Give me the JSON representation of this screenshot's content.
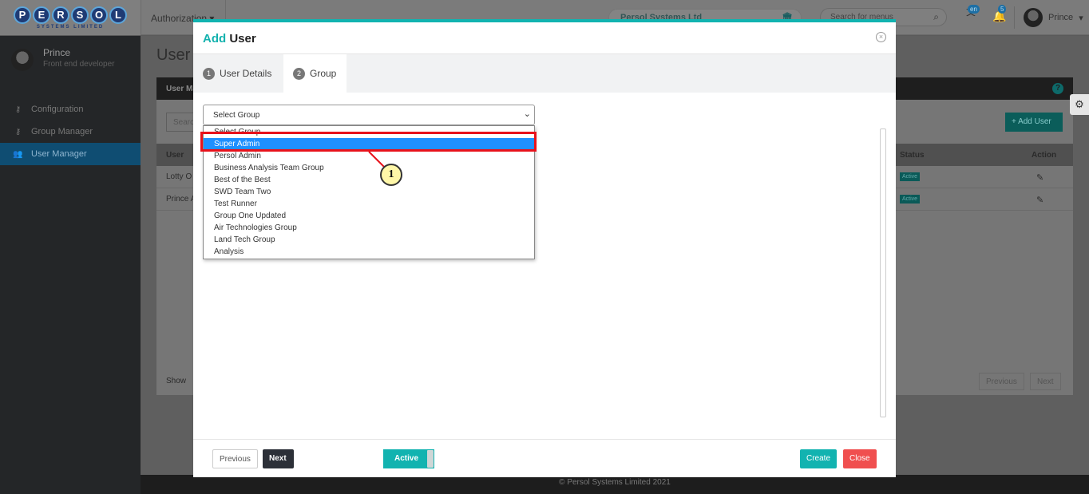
{
  "app": {
    "logo_letters": [
      "P",
      "E",
      "R",
      "S",
      "O",
      "L"
    ],
    "logo_sub": "SYSTEMS LIMITED",
    "menu": "Authorization",
    "company": "Persol Systems Ltd",
    "search_placeholder": "Search for menus",
    "lang_badge": "en",
    "notif_badge": "5",
    "user": "Prince"
  },
  "sidebar": {
    "name": "Prince",
    "role": "Front end developer",
    "items": [
      {
        "label": "Configuration",
        "icon": "key-icon"
      },
      {
        "label": "Group Manager",
        "icon": "key-icon"
      },
      {
        "label": "User Manager",
        "icon": "users-icon",
        "active": true
      }
    ]
  },
  "background": {
    "title": "User",
    "card_head": "User Ma",
    "search": "Searc",
    "add_user": "Add User",
    "columns": {
      "user": "User",
      "status": "Status",
      "action": "Action"
    },
    "rows": [
      {
        "user": "Lotty O",
        "status": "Active"
      },
      {
        "user": "Prince A",
        "status": "Active"
      }
    ],
    "show_label": "Show",
    "previous": "Previous",
    "next": "Next"
  },
  "modal": {
    "title_prefix": "Add",
    "title_suffix": "User",
    "tabs": [
      {
        "num": "1",
        "label": "User Details"
      },
      {
        "num": "2",
        "label": "Group",
        "active": true
      }
    ],
    "select_value": "Select Group",
    "options": [
      "Select Group",
      "Super Admin",
      "Persol Admin",
      "Business Analysis Team Group",
      "Best of the Best",
      "SWD Team Two",
      "Test Runner",
      "Group One Updated",
      "Air Technologies Group",
      "Land Tech Group",
      "Analysis"
    ],
    "selected_option": "Super Admin",
    "footer": {
      "previous": "Previous",
      "next": "Next",
      "toggle": "Active",
      "create": "Create",
      "close": "Close"
    }
  },
  "annotation": {
    "callout_number": "1",
    "highlight_color": "#e8121b"
  },
  "footer": "© Persol Systems Limited 2021",
  "colors": {
    "accent": "#12b3b0",
    "danger": "#f04f4f",
    "selected": "#1e90ff"
  }
}
